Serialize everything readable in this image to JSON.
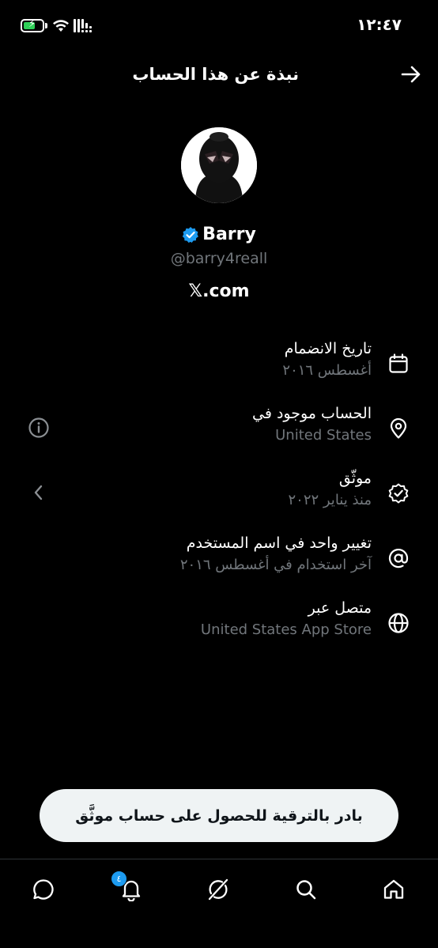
{
  "status_bar": {
    "time": "١٢:٤٧"
  },
  "header": {
    "title": "نبذة عن هذا الحساب",
    "back_icon": "arrow-right-icon"
  },
  "profile": {
    "display_name": "Barry",
    "handle": "@barry4reall",
    "platform": "𝕏.com",
    "verified_color": "#1d9bf0"
  },
  "info_items": [
    {
      "label": "تاريخ الانضمام",
      "value": "أغسطس ٢٠١٦",
      "icon": "calendar-icon"
    },
    {
      "label": "الحساب موجود في",
      "value": "United States",
      "icon": "location-pin-icon",
      "left_icon": "info-icon"
    },
    {
      "label": "موثّق",
      "value": "منذ يناير ٢٠٢٢",
      "icon": "verified-badge-icon",
      "left_icon": "chevron-left-icon"
    },
    {
      "label": "تغيير واحد في اسم المستخدم",
      "value": "آخر استخدام في أغسطس ٢٠١٦",
      "icon": "at-sign-icon"
    },
    {
      "label": "متصل عبر",
      "value": "United States App Store",
      "icon": "globe-icon"
    }
  ],
  "upgrade_button": {
    "label": "بادر بالترقية للحصول على حساب موثَّق"
  },
  "bottom_nav": {
    "items": [
      "messages-icon",
      "notifications-icon",
      "grok-icon",
      "search-icon",
      "home-icon"
    ],
    "notification_count": "٤"
  }
}
